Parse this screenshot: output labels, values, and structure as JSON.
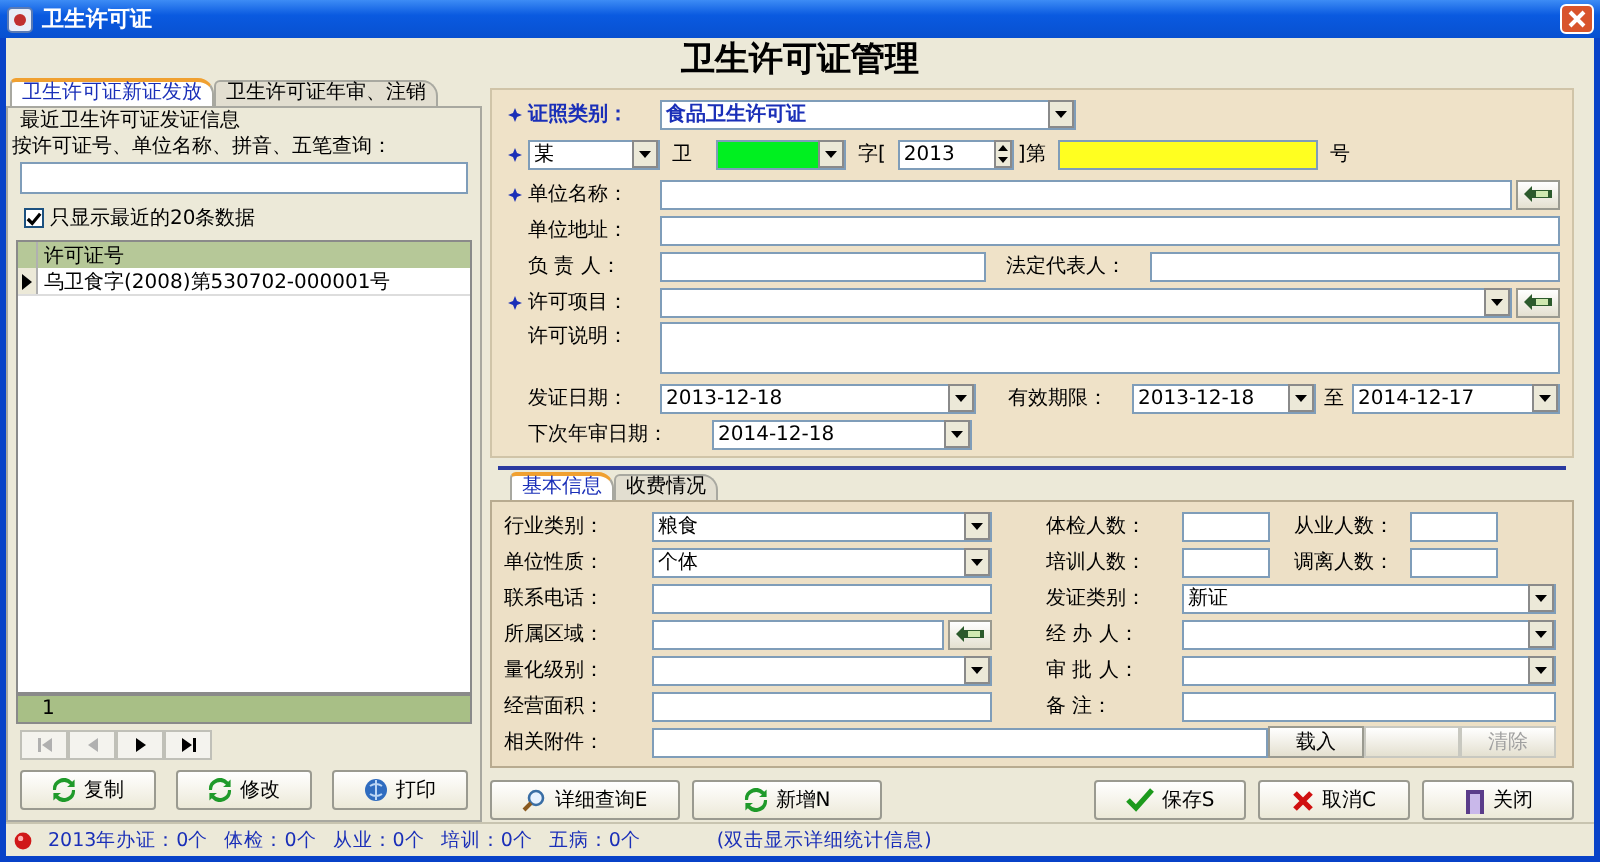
{
  "window": {
    "title": "卫生许可证"
  },
  "header": {
    "title": "卫生许可证管理"
  },
  "left_tabs": [
    {
      "label": "卫生许可证新证发放",
      "selected": true
    },
    {
      "label": "卫生许可证年审、注销",
      "selected": false
    }
  ],
  "recent": {
    "heading": "最近卫生许可证发证信息",
    "search_label": "按许可证号、单位名称、拼音、五笔查询："
  },
  "recent_only": {
    "label": "只显示最近的20条数据",
    "checked": true
  },
  "grid": {
    "columns": [
      "许可证号"
    ],
    "rows": [
      {
        "cells": [
          "乌卫食字(2008)第530702-000001号"
        ],
        "selected": true
      }
    ],
    "footer": "1"
  },
  "nav_buttons": [
    {
      "kind": "first",
      "disabled": true
    },
    {
      "kind": "prev",
      "disabled": true
    },
    {
      "kind": "next",
      "disabled": false
    },
    {
      "kind": "last",
      "disabled": false
    }
  ],
  "left_buttons": [
    {
      "label": "复制",
      "kind": "refresh"
    },
    {
      "label": "修改",
      "kind": "refresh"
    },
    {
      "label": "打印",
      "kind": "print"
    }
  ],
  "form": {
    "license_type": {
      "label": "证照类别：",
      "value": "食品卫生许可证",
      "required": true
    },
    "license_number": {
      "required": true,
      "region": "某",
      "text_1": "卫",
      "text_2": "字[",
      "year": "2013",
      "text_3": "]第",
      "text_4": "号"
    },
    "unit_name": {
      "label": "单位名称：",
      "required": true
    },
    "unit_address": {
      "label": "单位地址：",
      "required": false
    },
    "person_in_charge": {
      "label": "负 责 人：",
      "required": false
    },
    "legal_rep": {
      "label": "法定代表人："
    },
    "permit_items": {
      "label": "许可项目：",
      "required": true
    },
    "permit_note": {
      "label": "许可说明：",
      "required": false
    },
    "issue_date": {
      "label": "发证日期：",
      "value": "2013-12-18",
      "required": false
    },
    "valid_period": {
      "label": "有效期限：",
      "from": "2013-12-18",
      "to_label": "至",
      "to": "2014-12-17"
    },
    "next_review": {
      "label": "下次年审日期：",
      "value": "2014-12-18"
    }
  },
  "detail_tabs": [
    {
      "label": "基本信息",
      "selected": true
    },
    {
      "label": "收费情况",
      "selected": false
    }
  ],
  "detail": {
    "left": [
      {
        "kind": "combo",
        "label": "行业类别：",
        "value": "粮食"
      },
      {
        "kind": "combo",
        "label": "单位性质：",
        "value": "个体"
      },
      {
        "kind": "text",
        "label": "联系电话："
      },
      {
        "kind": "lookup",
        "label": "所属区域："
      },
      {
        "kind": "combo",
        "label": "量化级别："
      },
      {
        "kind": "text",
        "label": "经营面积："
      }
    ],
    "counts": [
      {
        "label": "体检人数："
      },
      {
        "label": "从业人数："
      },
      {
        "label": "培训人数："
      },
      {
        "label": "调离人数："
      }
    ],
    "right": [
      {
        "kind": "combo",
        "label": "发证类别：",
        "value": "新证"
      },
      {
        "kind": "combo",
        "label": "经 办 人："
      },
      {
        "kind": "combo",
        "label": "审 批 人："
      },
      {
        "kind": "text",
        "label": "备    注："
      }
    ],
    "attachment": {
      "label": "相关附件：",
      "buttons": [
        {
          "label": "载入",
          "disabled": false
        },
        {
          "disabled": true
        },
        {
          "label": "清除",
          "disabled": true
        }
      ]
    }
  },
  "actions": [
    {
      "label": "详细查询E",
      "kind": "search"
    },
    {
      "label": "新增N",
      "kind": "refresh"
    },
    {
      "label": "保存S",
      "kind": "check"
    },
    {
      "label": "取消C",
      "kind": "cancel"
    },
    {
      "label": "关闭",
      "kind": "exit"
    }
  ],
  "status_bar": {
    "alert": true,
    "items": [
      "2013年办证：0个",
      "体检：0个",
      "从业：0个",
      "培训：0个",
      "五病：0个"
    ],
    "hint": "(双击显示详细统计信息)"
  }
}
